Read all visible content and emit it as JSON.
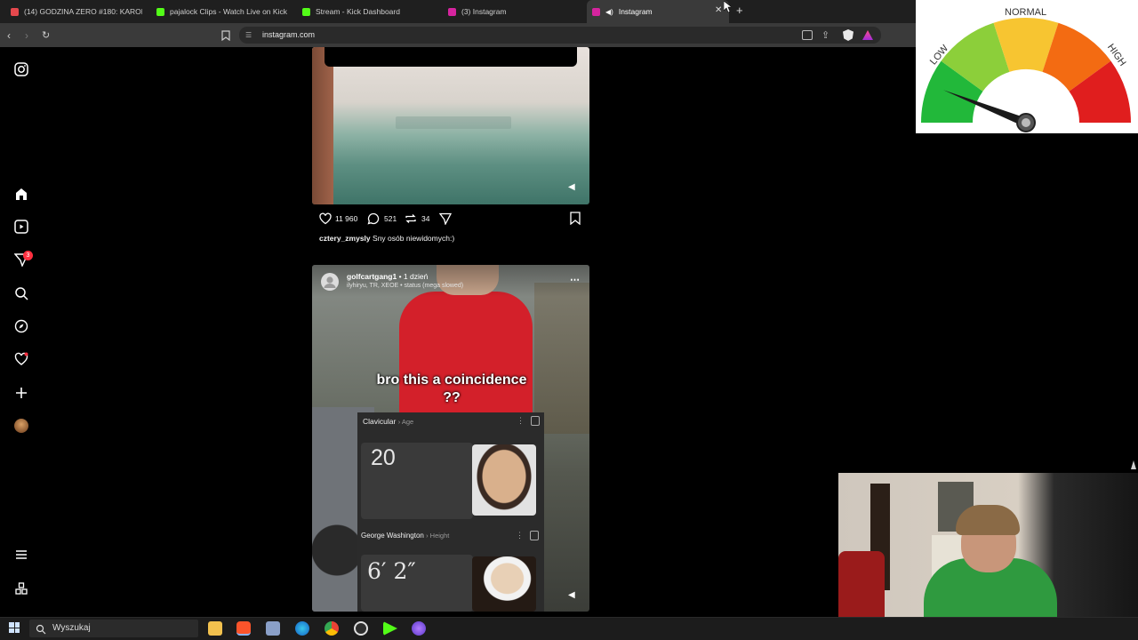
{
  "browser": {
    "tabs": [
      {
        "label": "(14) GODZINA ZERO #180: KAROL N",
        "color": "#e5484d"
      },
      {
        "label": "pajalock Clips - Watch Live on Kick",
        "color": "#53fc18"
      },
      {
        "label": "Stream - Kick Dashboard",
        "color": "#53fc18"
      },
      {
        "label": "(3) Instagram",
        "color": "#d6249f"
      },
      {
        "label": "Instagram",
        "color": "#d6249f"
      }
    ],
    "url": "instagram.com"
  },
  "post1": {
    "likes": "11 960",
    "comments": "521",
    "shares": "34",
    "caption_user": "cztery_zmysly",
    "caption_text": "Sny osób niewidomych:)"
  },
  "post2": {
    "username": "golfcartgang1",
    "time": "• 1 dzień",
    "audio": "ilyhiryu, TR, XEOE • status (mega slowed)",
    "overlay_text": "bro this a coincidence ??",
    "card1_title": "Clavicular",
    "card1_sub": "› Age",
    "card1_value": "20",
    "card2_title": "George Washington",
    "card2_sub": "› Height",
    "card2_value": "6′ 2″"
  },
  "gauge": {
    "label_low": "LOW",
    "label_normal": "NORMAL",
    "label_high": "HIGH",
    "level": 0.12
  },
  "rail": {
    "notification_count": "3"
  },
  "taskbar": {
    "search_placeholder": "Wyszukaj"
  }
}
